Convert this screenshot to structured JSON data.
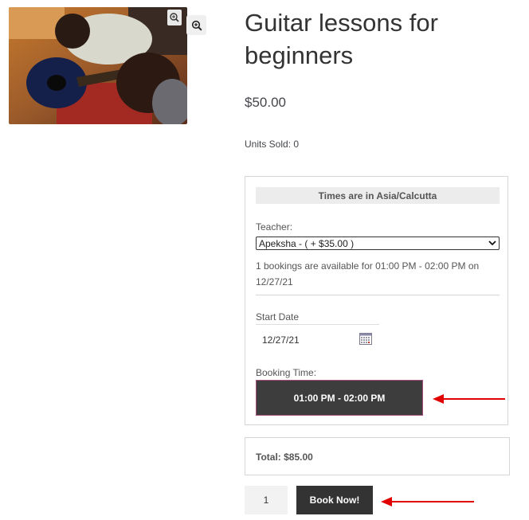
{
  "product": {
    "title": "Guitar lessons for beginners",
    "price": "$50.00",
    "units_sold": "Units Sold: 0"
  },
  "booking": {
    "timezone_note": "Times are in Asia/Calcutta",
    "teacher_label": "Teacher:",
    "teacher_selected": "Apeksha - ( + $35.00 )",
    "availability_text": "1 bookings are available for 01:00 PM - 02:00 PM on 12/27/21",
    "start_date_label": "Start Date",
    "start_date_value": "12/27/21",
    "booking_time_label": "Booking Time:",
    "time_slot": "01:00 PM - 02:00 PM"
  },
  "total": {
    "text": "Total: $85.00"
  },
  "cart": {
    "quantity": "1",
    "book_label": "Book Now!"
  },
  "colors": {
    "button_bg": "#333333",
    "slot_border": "#a64d79",
    "annotation_arrow": "#e00000"
  },
  "icons": [
    "zoom-in-icon",
    "calendar-icon",
    "chevron-down-icon",
    "red-arrow-annotation"
  ]
}
